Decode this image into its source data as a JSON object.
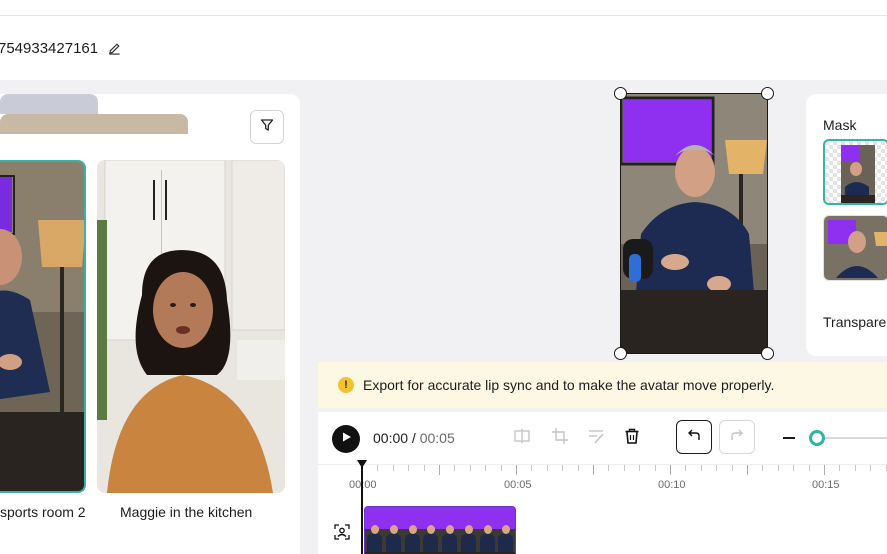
{
  "header": {
    "project_title": "754933427161"
  },
  "library": {
    "avatars": [
      {
        "name": "sports room 2",
        "selected": true
      },
      {
        "name": "Maggie in the kitchen",
        "selected": false
      }
    ]
  },
  "mask_panel": {
    "title": "Mask",
    "transparent_label": "Transpare"
  },
  "notice": {
    "message": "Export for accurate lip sync and to make the avatar move properly."
  },
  "timeline": {
    "current_time": "00:00",
    "separator": " / ",
    "total_time": "00:05",
    "ruler_labels": [
      "00:00",
      "00:05",
      "00:10",
      "00:15"
    ],
    "zoom_level": 0.05
  },
  "colors": {
    "accent": "#33b4a6",
    "warning_bg": "#fdf8e4",
    "warning_icon": "#f2c230",
    "clip_border": "#6a34c9",
    "screen_purple": "#8f2ff0"
  }
}
